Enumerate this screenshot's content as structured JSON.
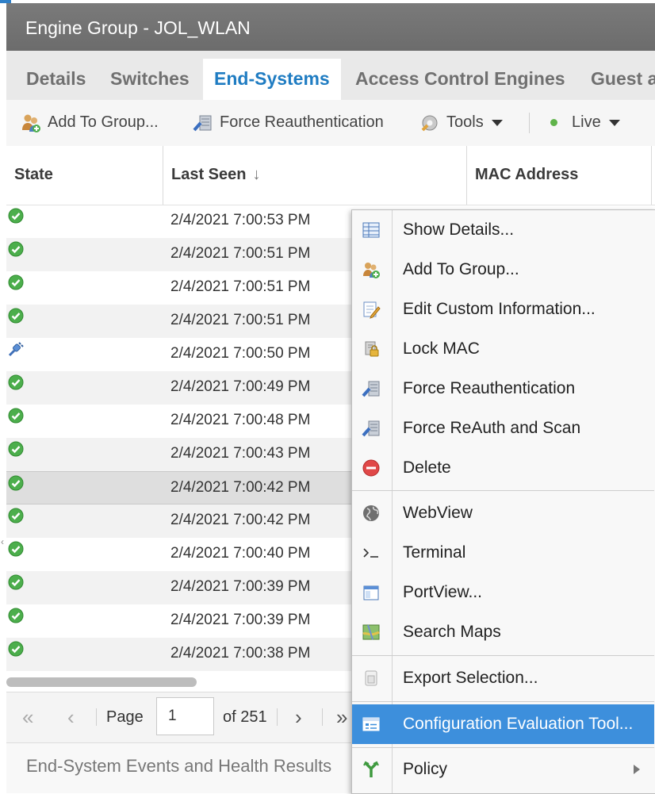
{
  "window": {
    "title": "Engine Group - JOL_WLAN"
  },
  "tabs": [
    "Details",
    "Switches",
    "End-Systems",
    "Access Control Engines",
    "Guest a"
  ],
  "active_tab": "End-Systems",
  "toolbar": {
    "add_to_group": "Add To Group...",
    "force_reauth": "Force Reauthentication",
    "tools": "Tools",
    "live": "Live"
  },
  "table": {
    "columns": [
      "State",
      "Last Seen",
      "MAC Address"
    ],
    "sort_indicator": "↓",
    "rows": [
      {
        "state": "ok",
        "last_seen": "2/4/2021 7:00:53 PM"
      },
      {
        "state": "ok",
        "last_seen": "2/4/2021 7:00:51 PM"
      },
      {
        "state": "ok",
        "last_seen": "2/4/2021 7:00:51 PM"
      },
      {
        "state": "ok",
        "last_seen": "2/4/2021 7:00:51 PM"
      },
      {
        "state": "connecting",
        "last_seen": "2/4/2021 7:00:50 PM"
      },
      {
        "state": "ok",
        "last_seen": "2/4/2021 7:00:49 PM"
      },
      {
        "state": "ok",
        "last_seen": "2/4/2021 7:00:48 PM"
      },
      {
        "state": "ok",
        "last_seen": "2/4/2021 7:00:43 PM"
      },
      {
        "state": "ok",
        "last_seen": "2/4/2021 7:00:42 PM"
      },
      {
        "state": "ok",
        "last_seen": "2/4/2021 7:00:42 PM"
      },
      {
        "state": "ok",
        "last_seen": "2/4/2021 7:00:40 PM"
      },
      {
        "state": "ok",
        "last_seen": "2/4/2021 7:00:39 PM"
      },
      {
        "state": "ok",
        "last_seen": "2/4/2021 7:00:39 PM"
      },
      {
        "state": "ok",
        "last_seen": "2/4/2021 7:00:38 PM"
      }
    ],
    "selected_row_index": 8
  },
  "pager": {
    "first": "«",
    "prev": "‹",
    "page_label": "Page",
    "page_value": "1",
    "of_total": "of 251",
    "next": "›",
    "last": "»"
  },
  "bottom_panel": {
    "title": "End-System Events and Health Results"
  },
  "context_menu": {
    "items": [
      {
        "label": "Show Details...",
        "icon": "table-icon"
      },
      {
        "label": "Add To Group...",
        "icon": "users-add-icon"
      },
      {
        "label": "Edit Custom Information...",
        "icon": "edit-note-icon"
      },
      {
        "label": "Lock MAC",
        "icon": "lock-icon"
      },
      {
        "label": "Force Reauthentication",
        "icon": "reauth-icon"
      },
      {
        "label": "Force ReAuth and Scan",
        "icon": "reauth-scan-icon"
      },
      {
        "label": "Delete",
        "icon": "delete-icon"
      },
      {
        "label": "WebView",
        "icon": "globe-icon"
      },
      {
        "label": "Terminal",
        "icon": "terminal-icon"
      },
      {
        "label": "PortView...",
        "icon": "window-icon"
      },
      {
        "label": "Search Maps",
        "icon": "map-icon"
      },
      {
        "label": "Export Selection...",
        "icon": "export-icon"
      },
      {
        "label": "Configuration Evaluation Tool...",
        "icon": "config-eval-icon"
      },
      {
        "label": "Policy",
        "icon": "policy-icon"
      }
    ],
    "highlighted": "Configuration Evaluation Tool..."
  },
  "colors": {
    "title_bar": "#6f6f6f",
    "active_tab_text": "#1f7cc2",
    "menu_highlight": "#3d8fdc",
    "ok_state": "#4cae4c"
  }
}
